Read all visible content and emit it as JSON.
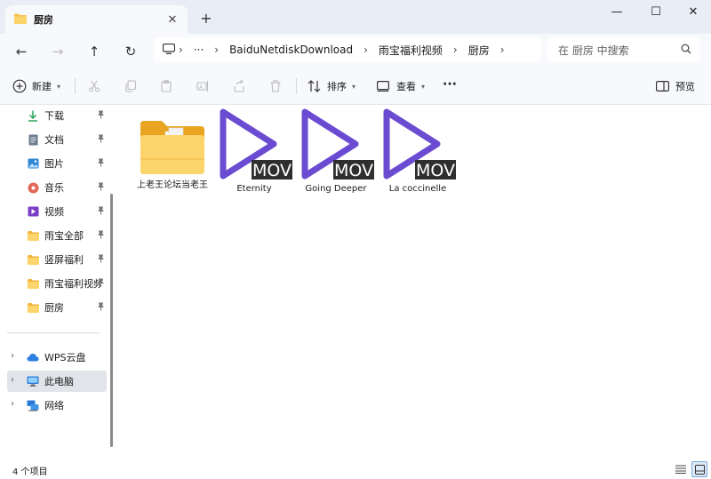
{
  "window": {
    "tab_title": "厨房",
    "tab_close": "✕",
    "new_tab": "+",
    "minimize": "—",
    "maximize": "☐",
    "close": "✕"
  },
  "nav": {
    "back": "←",
    "forward": "→",
    "up": "↑",
    "refresh": "↻",
    "more": "···"
  },
  "address": {
    "segments": [
      "BaiduNetdiskDownload",
      "雨宝福利视频",
      "厨房"
    ]
  },
  "search": {
    "placeholder": "在 厨房 中搜索"
  },
  "toolbar": {
    "new_label": "新建",
    "sort_label": "排序",
    "view_label": "查看",
    "more": "···",
    "preview_label": "预览"
  },
  "sidebar": {
    "quick": [
      {
        "label": "下载",
        "icon": "download-icon"
      },
      {
        "label": "文档",
        "icon": "document-icon"
      },
      {
        "label": "图片",
        "icon": "picture-icon"
      },
      {
        "label": "音乐",
        "icon": "music-icon"
      },
      {
        "label": "视频",
        "icon": "video-icon"
      },
      {
        "label": "雨宝全部",
        "icon": "folder-icon"
      },
      {
        "label": "竖屏福利",
        "icon": "folder-icon"
      },
      {
        "label": "雨宝福利视频",
        "icon": "folder-icon"
      },
      {
        "label": "厨房",
        "icon": "folder-icon"
      }
    ],
    "tree": [
      {
        "label": "WPS云盘",
        "icon": "cloud-icon"
      },
      {
        "label": "此电脑",
        "icon": "computer-icon"
      },
      {
        "label": "网络",
        "icon": "network-icon"
      }
    ]
  },
  "files": [
    {
      "name": "上老王论坛当老王",
      "type": "folder",
      "badge": ""
    },
    {
      "name": "Eternity",
      "type": "video",
      "badge": "MOV"
    },
    {
      "name": "Going  Deeper",
      "type": "video",
      "badge": "MOV"
    },
    {
      "name": "La  coccinelle",
      "type": "video",
      "badge": "MOV"
    }
  ],
  "status": {
    "count_text": "4 个项目"
  },
  "colors": {
    "accent": "#6a4bd1",
    "folder": "#f6c350",
    "selection": "#e1e4e8"
  }
}
